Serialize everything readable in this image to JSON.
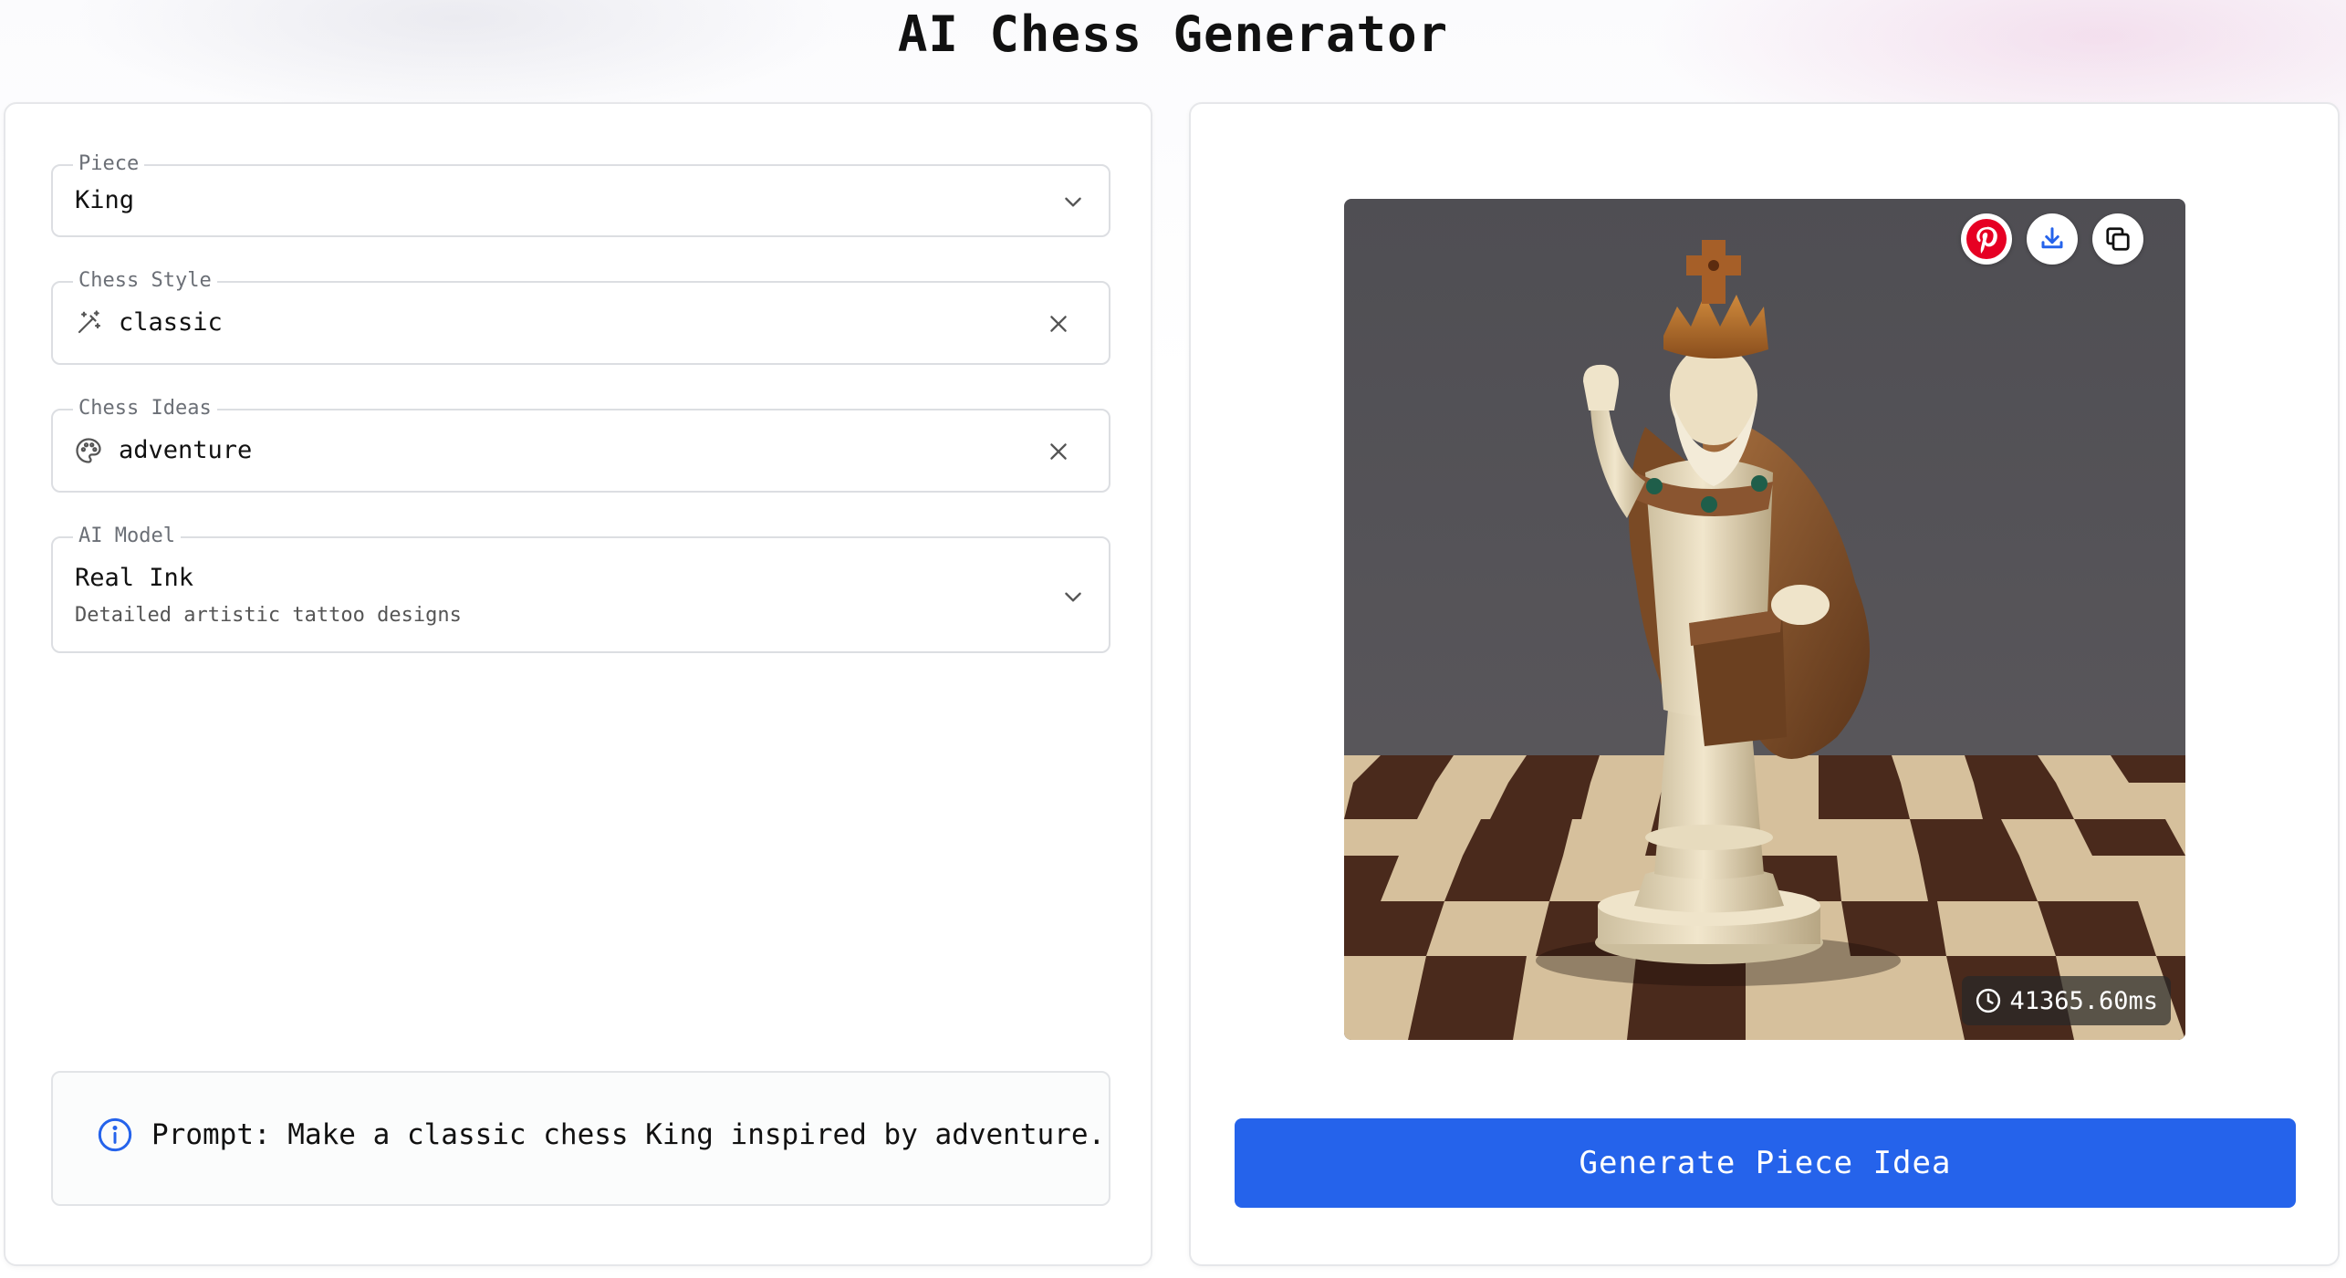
{
  "header": {
    "title": "AI Chess Generator"
  },
  "form": {
    "piece": {
      "label": "Piece",
      "value": "King",
      "icon": "chevron-down-icon"
    },
    "style": {
      "label": "Chess Style",
      "value": "classic",
      "icon": "magic-wand-icon",
      "clear_icon": "close-icon"
    },
    "ideas": {
      "label": "Chess Ideas",
      "value": "adventure",
      "icon": "palette-icon",
      "clear_icon": "close-icon"
    },
    "model": {
      "label": "AI Model",
      "value": "Real Ink",
      "description": "Detailed artistic tattoo designs",
      "icon": "chevron-down-icon"
    }
  },
  "prompt": {
    "text": "Prompt: Make a classic chess King inspired by adventure.",
    "icon": "info-icon"
  },
  "preview": {
    "alt": "Generated chess king piece with crown, beard, brown cloak and satchel on a chessboard",
    "actions": [
      "pinterest-icon",
      "download-icon",
      "copy-icon"
    ],
    "time": "41365.60ms",
    "time_icon": "clock-icon"
  },
  "actions": {
    "generate_label": "Generate Piece Idea"
  },
  "colors": {
    "primary": "#2563eb",
    "pinterest": "#e60023",
    "board_dark": "#4a2a1c",
    "board_light": "#d8c3a2"
  }
}
